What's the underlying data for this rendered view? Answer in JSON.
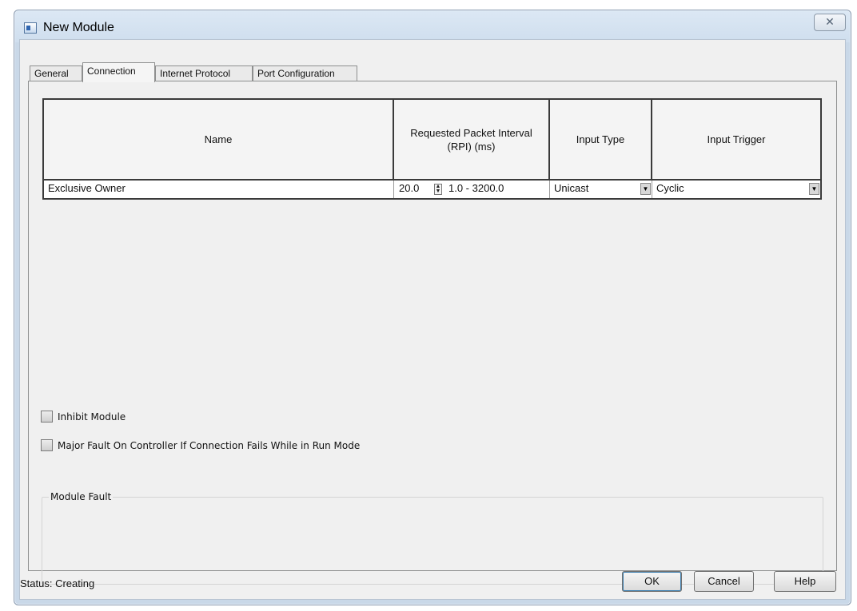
{
  "window": {
    "title": "New Module",
    "close_glyph": "✕",
    "icon": "module-window-icon"
  },
  "tabs": [
    {
      "label": "General",
      "active": false
    },
    {
      "label": "Connection",
      "active": true
    },
    {
      "label": "Internet Protocol",
      "active": false
    },
    {
      "label": "Port Configuration",
      "active": false
    }
  ],
  "grid": {
    "columns": [
      "Name",
      "Requested Packet Interval (RPI) (ms)",
      "Input Type",
      "Input Trigger"
    ],
    "rows": [
      {
        "name": "Exclusive Owner",
        "rpi": "20.0",
        "rpi_range": "1.0 - 3200.0",
        "input_type": "Unicast",
        "input_trigger": "Cyclic"
      }
    ]
  },
  "options": {
    "inhibit_module": {
      "label": "Inhibit Module",
      "checked": false
    },
    "major_fault": {
      "label": "Major Fault On Controller If Connection Fails While in Run Mode",
      "checked": false
    }
  },
  "module_fault": {
    "label": "Module Fault",
    "text": ""
  },
  "status": {
    "text": "Status: Creating"
  },
  "buttons": {
    "ok": "OK",
    "cancel": "Cancel",
    "help": "Help"
  }
}
